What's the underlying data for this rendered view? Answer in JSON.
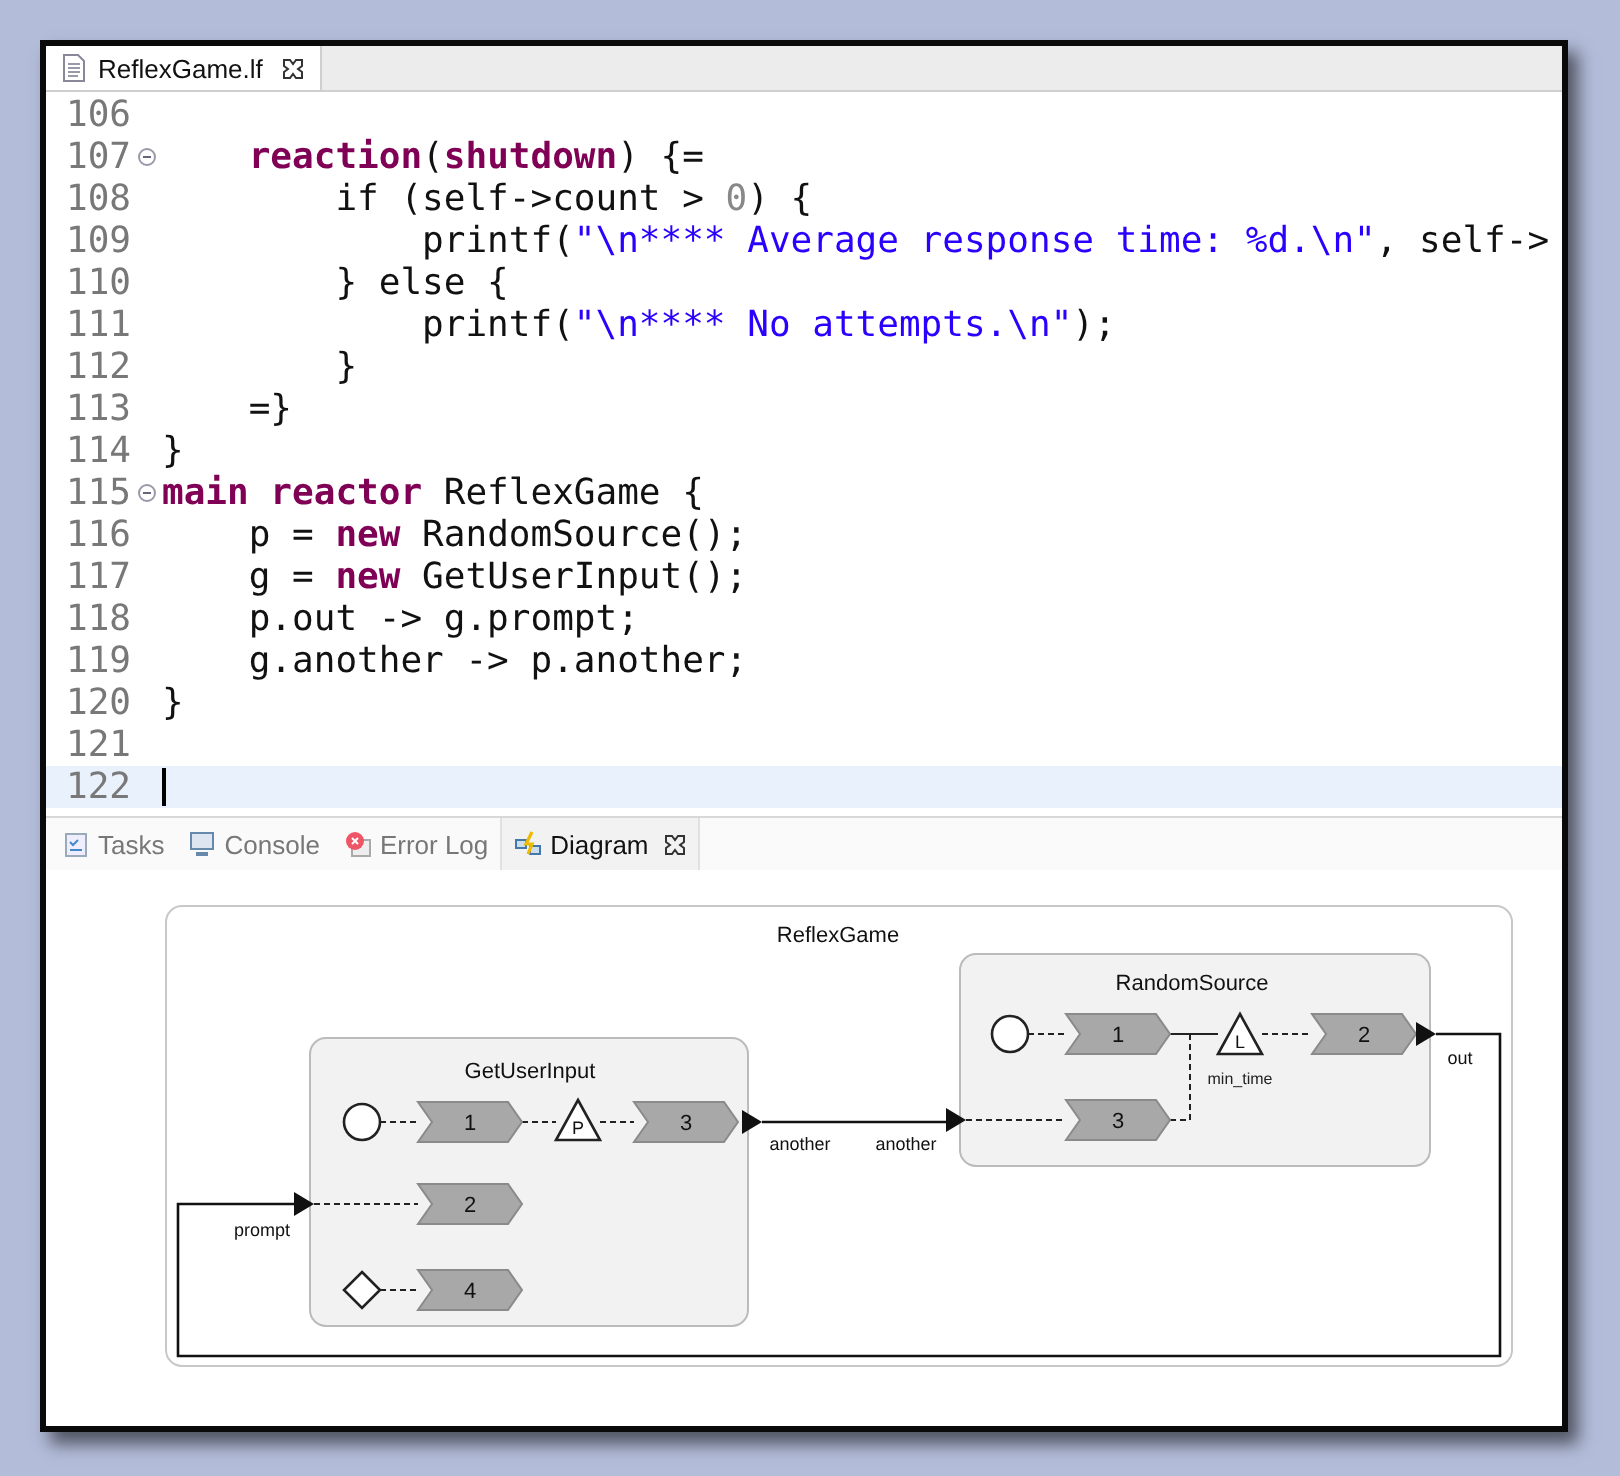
{
  "editor": {
    "tab": {
      "label": "ReflexGame.lf",
      "selected": true
    },
    "lines": [
      {
        "number": "106",
        "fold": false,
        "current": false
      },
      {
        "number": "107",
        "fold": true,
        "current": false,
        "tokens": [
          {
            "kind": "keyword",
            "text": "    reaction"
          },
          {
            "kind": "plain",
            "text": "("
          },
          {
            "kind": "keyword",
            "text": "shutdown"
          },
          {
            "kind": "plain",
            "text": ") {="
          }
        ]
      },
      {
        "number": "108",
        "fold": false,
        "current": false,
        "tokens": [
          {
            "kind": "plain",
            "text": "        if (self->count > "
          },
          {
            "kind": "number",
            "text": "0"
          },
          {
            "kind": "plain",
            "text": ") {"
          }
        ]
      },
      {
        "number": "109",
        "fold": false,
        "current": false,
        "tokens": [
          {
            "kind": "plain",
            "text": "            printf("
          },
          {
            "kind": "string",
            "text": "\"\\n**** Average response time: %d.\\n\""
          },
          {
            "kind": "plain",
            "text": ", self->"
          }
        ]
      },
      {
        "number": "110",
        "fold": false,
        "current": false,
        "tokens": [
          {
            "kind": "plain",
            "text": "        } else {"
          }
        ]
      },
      {
        "number": "111",
        "fold": false,
        "current": false,
        "tokens": [
          {
            "kind": "plain",
            "text": "            printf("
          },
          {
            "kind": "string",
            "text": "\"\\n**** No attempts.\\n\""
          },
          {
            "kind": "plain",
            "text": ");"
          }
        ]
      },
      {
        "number": "112",
        "fold": false,
        "current": false,
        "tokens": [
          {
            "kind": "plain",
            "text": "        }"
          }
        ]
      },
      {
        "number": "113",
        "fold": false,
        "current": false,
        "tokens": [
          {
            "kind": "plain",
            "text": "    =}"
          }
        ]
      },
      {
        "number": "114",
        "fold": false,
        "current": false,
        "tokens": [
          {
            "kind": "plain",
            "text": "}"
          }
        ]
      },
      {
        "number": "115",
        "fold": true,
        "current": false,
        "tokens": [
          {
            "kind": "keyword",
            "text": "main reactor"
          },
          {
            "kind": "plain",
            "text": " ReflexGame {"
          }
        ]
      },
      {
        "number": "116",
        "fold": false,
        "current": false,
        "tokens": [
          {
            "kind": "plain",
            "text": "    p = "
          },
          {
            "kind": "keyword",
            "text": "new"
          },
          {
            "kind": "plain",
            "text": " RandomSource();"
          }
        ]
      },
      {
        "number": "117",
        "fold": false,
        "current": false,
        "tokens": [
          {
            "kind": "plain",
            "text": "    g = "
          },
          {
            "kind": "keyword",
            "text": "new"
          },
          {
            "kind": "plain",
            "text": " GetUserInput();"
          }
        ]
      },
      {
        "number": "118",
        "fold": false,
        "current": false,
        "tokens": [
          {
            "kind": "plain",
            "text": "    p.out -> g.prompt;"
          }
        ]
      },
      {
        "number": "119",
        "fold": false,
        "current": false,
        "tokens": [
          {
            "kind": "plain",
            "text": "    g.another -> p.another;"
          }
        ]
      },
      {
        "number": "120",
        "fold": false,
        "current": false,
        "tokens": [
          {
            "kind": "plain",
            "text": "}"
          }
        ]
      },
      {
        "number": "121",
        "fold": false,
        "current": false
      },
      {
        "number": "122",
        "fold": false,
        "current": true
      }
    ]
  },
  "panel": {
    "tabs": [
      {
        "label": "Tasks",
        "kind": "tasks",
        "selected": false
      },
      {
        "label": "Console",
        "kind": "console",
        "selected": false
      },
      {
        "label": "Error Log",
        "kind": "errorlog",
        "selected": false
      },
      {
        "label": "Diagram",
        "kind": "diagram",
        "selected": true
      }
    ]
  },
  "diagram": {
    "title": "ReflexGame",
    "reactors": [
      {
        "name": "GetUserInput",
        "reactions": [
          "1",
          "3",
          "2",
          "4"
        ],
        "action": "P",
        "input": "prompt",
        "output": "another"
      },
      {
        "name": "RandomSource",
        "reactions": [
          "1",
          "2",
          "3"
        ],
        "action": "L",
        "action_label": "min_time",
        "input": "another",
        "output": "out"
      }
    ]
  }
}
